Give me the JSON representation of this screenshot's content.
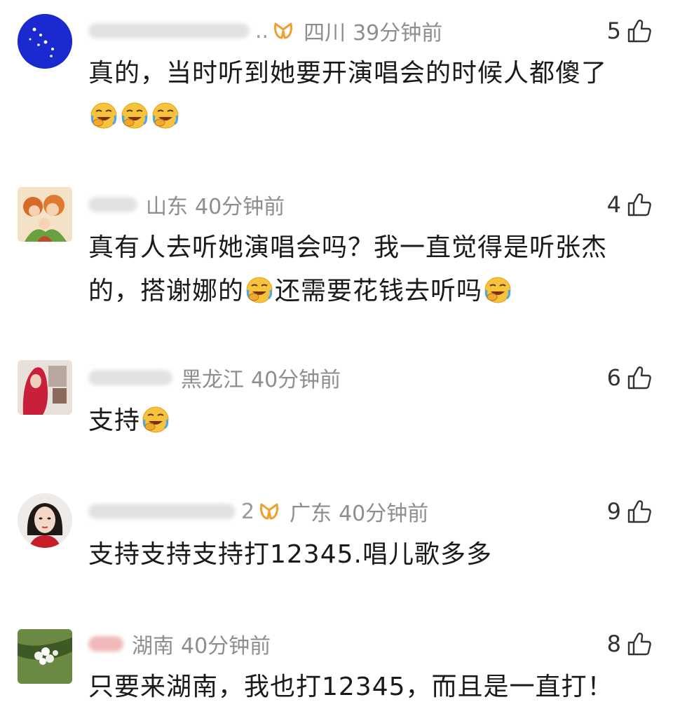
{
  "comments": [
    {
      "name_tail": "..",
      "has_vip": true,
      "region": "四川",
      "time": "39分钟前",
      "likes": "5",
      "text": "真的，当时听到她要开演唱会的时候人都傻了",
      "emoji_after": [
        "facepalm-laugh-emoji",
        "facepalm-laugh-emoji",
        "facepalm-laugh-emoji"
      ],
      "avatar": "starry-blue-avatar"
    },
    {
      "name_tail": "",
      "has_vip": false,
      "region": "山东",
      "time": "40分钟前",
      "likes": "4",
      "text_lines": [
        "真有人去听她演唱会吗？我一直觉得是听张杰",
        "的，搭谢娜的",
        "还需要花钱去听吗"
      ],
      "avatar": "cartoon-family-avatar"
    },
    {
      "name_tail": "",
      "has_vip": false,
      "region": "黑龙江",
      "time": "40分钟前",
      "likes": "6",
      "text": "支持",
      "emoji_after": [
        "facepalm-laugh-emoji"
      ],
      "avatar": "red-hair-avatar"
    },
    {
      "name_tail": "2",
      "has_vip": true,
      "region": "广东",
      "time": "40分钟前",
      "likes": "9",
      "text": "支持支持支持打12345.唱儿歌多多",
      "avatar": "woman-portrait-avatar"
    },
    {
      "name_tail": "",
      "has_vip": false,
      "region": "湖南",
      "time": "40分钟前",
      "likes": "8",
      "text": "只要来湖南，我也打12345，而且是一直打！",
      "avatar": "white-flower-avatar"
    }
  ],
  "colors": {
    "meta_gray": "#8e8e8e",
    "vip_orange": "#f0a030",
    "emoji_yellow": "#f7c23c"
  }
}
